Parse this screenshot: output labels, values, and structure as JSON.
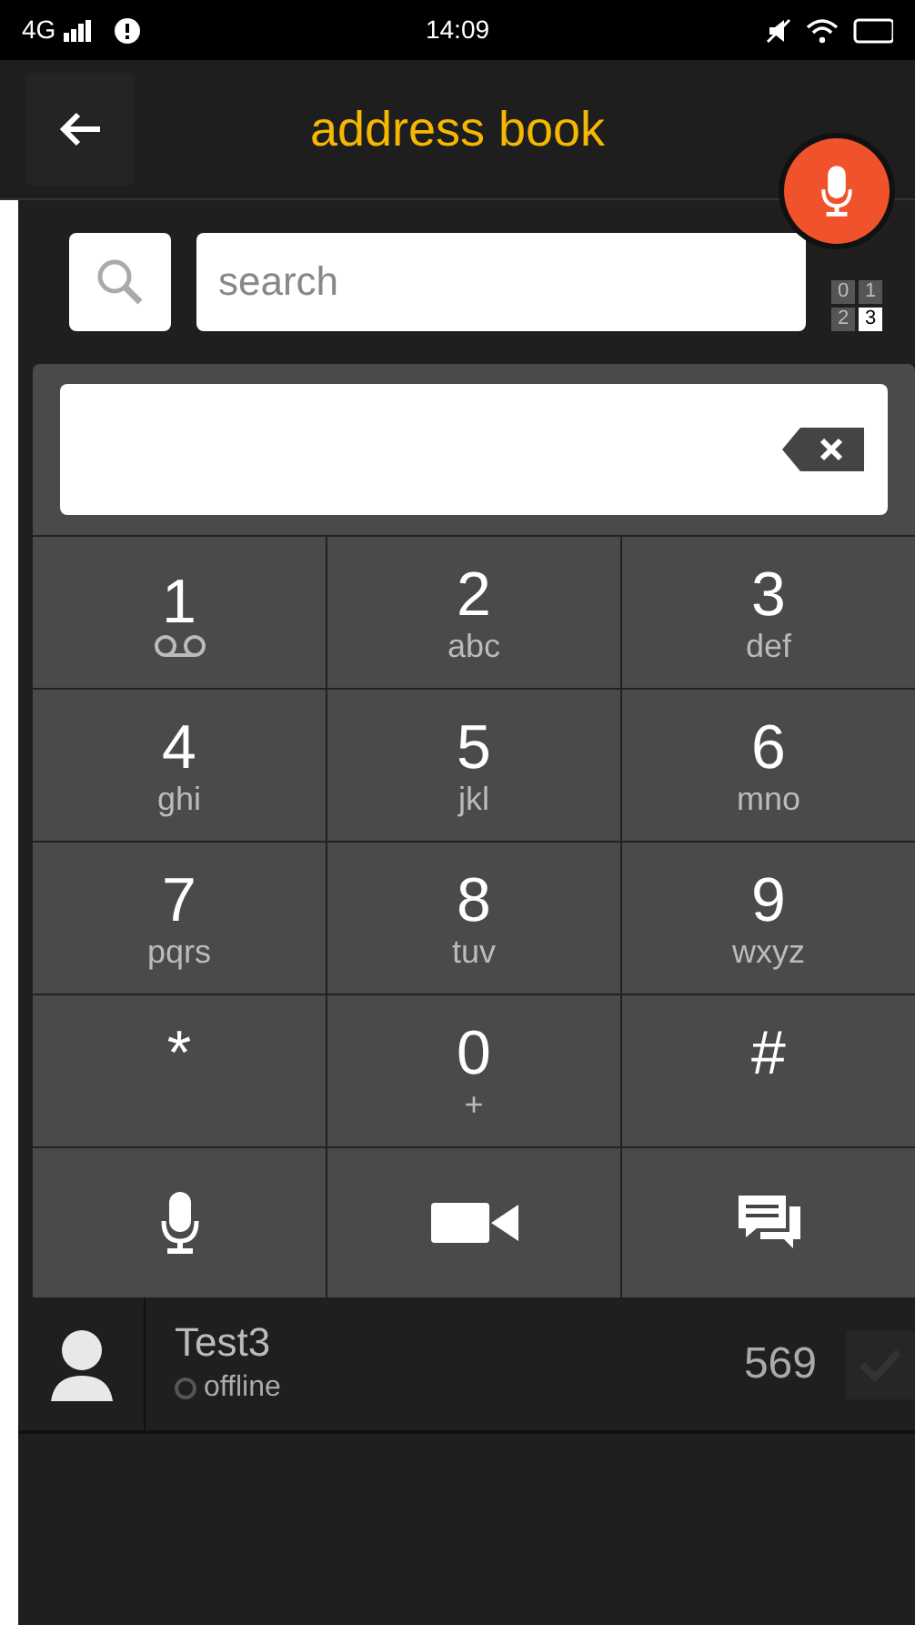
{
  "status_bar": {
    "network": "4G",
    "time": "14:09"
  },
  "header": {
    "title": "address book"
  },
  "search": {
    "placeholder": "search"
  },
  "mode_grid": [
    {
      "label": "0",
      "selected": false
    },
    {
      "label": "1",
      "selected": false
    },
    {
      "label": "2",
      "selected": false
    },
    {
      "label": "3",
      "selected": true
    }
  ],
  "dialpad": {
    "keys": [
      {
        "label": "1",
        "kind": "voicemail"
      },
      {
        "label": "2",
        "kind": "letters",
        "letters": "abc"
      },
      {
        "label": "3",
        "kind": "letters",
        "letters": "def"
      },
      {
        "label": "4",
        "kind": "letters",
        "letters": "ghi"
      },
      {
        "label": "5",
        "kind": "letters",
        "letters": "jkl"
      },
      {
        "label": "6",
        "kind": "letters",
        "letters": "mno"
      },
      {
        "label": "7",
        "kind": "letters",
        "letters": "pqrs"
      },
      {
        "label": "8",
        "kind": "letters",
        "letters": "tuv"
      },
      {
        "label": "9",
        "kind": "letters",
        "letters": "wxyz"
      },
      {
        "label": "*",
        "kind": "plain"
      },
      {
        "label": "0",
        "kind": "letters",
        "letters": "+"
      },
      {
        "label": "#",
        "kind": "plain"
      }
    ],
    "actions": [
      {
        "kind": "mic"
      },
      {
        "kind": "video"
      },
      {
        "kind": "chat"
      }
    ]
  },
  "contacts": [
    {
      "name": "Test3",
      "status": "offline",
      "online": false,
      "number": "569",
      "checked": false
    }
  ]
}
